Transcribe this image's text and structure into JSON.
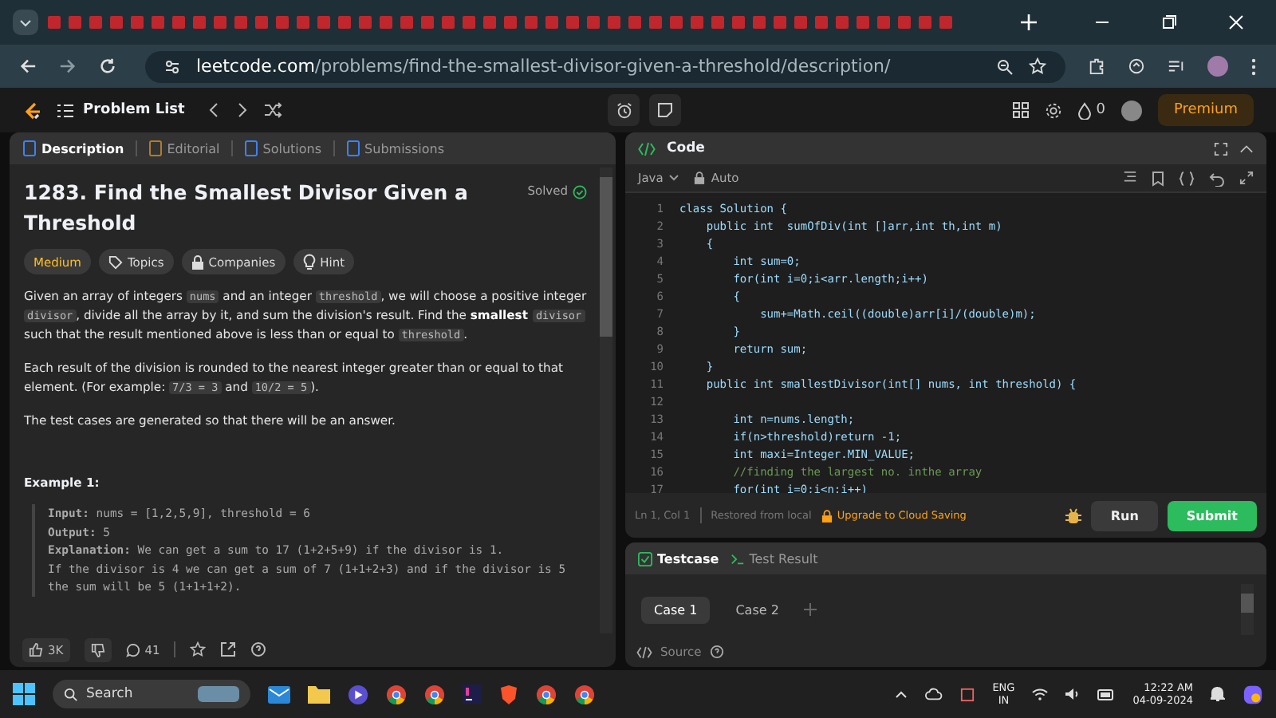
{
  "browser": {
    "url_host": "leetcode.com",
    "url_path": "/problems/find-the-smallest-divisor-given-a-threshold/description/"
  },
  "header": {
    "problem_list": "Problem List",
    "streak": "0",
    "premium": "Premium"
  },
  "left_tabs": [
    {
      "label": "Description",
      "selected": true
    },
    {
      "label": "Editorial",
      "selected": false
    },
    {
      "label": "Solutions",
      "selected": false
    },
    {
      "label": "Submissions",
      "selected": false
    }
  ],
  "problem": {
    "title": "1283. Find the Smallest Divisor Given a Threshold",
    "status": "Solved",
    "difficulty": "Medium",
    "tags": [
      "Topics",
      "Companies",
      "Hint"
    ],
    "paragraphs": [
      [
        {
          "kind": "text",
          "text": "Given an array of integers "
        },
        {
          "kind": "code",
          "text": "nums"
        },
        {
          "kind": "text",
          "text": " and an integer "
        },
        {
          "kind": "code",
          "text": "threshold"
        },
        {
          "kind": "text",
          "text": ", we will choose a positive integer "
        },
        {
          "kind": "code",
          "text": "divisor"
        },
        {
          "kind": "text",
          "text": ", divide all the array by it, and sum the division's result. Find the "
        },
        {
          "kind": "bold",
          "text": "smallest"
        },
        {
          "kind": "code",
          "text": "divisor"
        },
        {
          "kind": "text",
          "text": " such that the result mentioned above is less than or equal to "
        },
        {
          "kind": "code",
          "text": "threshold"
        },
        {
          "kind": "text",
          "text": "."
        }
      ],
      [
        {
          "kind": "text",
          "text": "Each result of the division is rounded to the nearest integer greater than or equal to that element. (For example: "
        },
        {
          "kind": "code",
          "text": "7/3 = 3"
        },
        {
          "kind": "text",
          "text": " and "
        },
        {
          "kind": "code",
          "text": "10/2 = 5"
        },
        {
          "kind": "text",
          "text": ")."
        }
      ],
      [
        {
          "kind": "text",
          "text": "The test cases are generated so that there will be an answer."
        }
      ]
    ],
    "example_title": "Example 1:",
    "example": "**Input:** nums = [1,2,5,9], threshold = 6\n**Output:** 5\n**Explanation:** We can get a sum to 17 (1+2+5+9) if the divisor is 1.\nIf the divisor is 4 we can get a sum of 7 (1+1+2+3) and if the divisor is 5 the sum will be 5 (1+1+1+2).",
    "likes": "3K",
    "comments": "41"
  },
  "code_panel": {
    "title": "Code",
    "language": "Java",
    "mode": "Auto",
    "lines": [
      {
        "n": "1",
        "kind": "code",
        "text": "class Solution {"
      },
      {
        "n": "2",
        "kind": "code",
        "text": "    public int  sumOfDiv(int []arr,int th,int m)"
      },
      {
        "n": "3",
        "kind": "code",
        "text": "    {"
      },
      {
        "n": "4",
        "kind": "code",
        "text": "        int sum=0;"
      },
      {
        "n": "5",
        "kind": "code",
        "text": "        for(int i=0;i<arr.length;i++)"
      },
      {
        "n": "6",
        "kind": "code",
        "text": "        {"
      },
      {
        "n": "7",
        "kind": "code",
        "text": "            sum+=Math.ceil((double)arr[i]/(double)m);"
      },
      {
        "n": "8",
        "kind": "code",
        "text": "        }"
      },
      {
        "n": "9",
        "kind": "code",
        "text": "        return sum;"
      },
      {
        "n": "10",
        "kind": "code",
        "text": "    }"
      },
      {
        "n": "11",
        "kind": "code",
        "text": "    public int smallestDivisor(int[] nums, int threshold) {"
      },
      {
        "n": "12",
        "kind": "blank"
      },
      {
        "n": "13",
        "kind": "code",
        "text": "        int n=nums.length;"
      },
      {
        "n": "14",
        "kind": "code",
        "text": "        if(n>threshold)return -1;"
      },
      {
        "n": "15",
        "kind": "code",
        "text": "        int maxi=Integer.MIN_VALUE;"
      },
      {
        "n": "16",
        "kind": "comment",
        "text": "        //finding the largest no. inthe array"
      },
      {
        "n": "17",
        "kind": "code",
        "text": "        for(int i=0;i<n;i++)"
      }
    ],
    "position": "Ln 1, Col 1",
    "restored": "Restored from local",
    "upgrade": "Upgrade to Cloud Saving",
    "run": "Run",
    "submit": "Submit"
  },
  "bottom_tabs": [
    {
      "label": "Testcase",
      "selected": true
    },
    {
      "label": "Test Result",
      "selected": false
    }
  ],
  "cases": [
    {
      "label": "Case 1",
      "selected": true
    },
    {
      "label": "Case 2",
      "selected": false
    }
  ],
  "source": "Source",
  "taskbar": {
    "search": "Search",
    "lang": "ENG",
    "region": "IN",
    "time": "12:22 AM",
    "date": "04-09-2024"
  }
}
